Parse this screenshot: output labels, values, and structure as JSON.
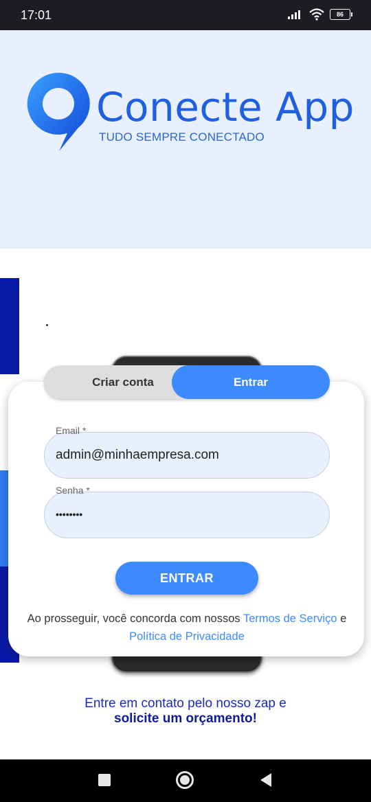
{
  "status_bar": {
    "time": "17:01",
    "battery": "86"
  },
  "brand": {
    "name": "Conecte App",
    "tagline": "TUDO SEMPRE CONECTADO"
  },
  "tabs": [
    {
      "label": "Criar conta",
      "active": false
    },
    {
      "label": "Entrar",
      "active": true
    }
  ],
  "form": {
    "email": {
      "label": "Email *",
      "value": "admin@minhaempresa.com"
    },
    "password": {
      "label": "Senha *",
      "value": "••••••••"
    },
    "submit_label": "ENTRAR"
  },
  "terms": {
    "prefix": "Ao prosseguir, você concorda com nossos ",
    "terms_link": "Termos de Serviço",
    "joiner": " e ",
    "privacy_link": "Política de Privacidade"
  },
  "contact": {
    "line1": "Entre em contato pelo nosso zap e",
    "line2": "solicite um orçamento!"
  },
  "colors": {
    "accent": "#3d8bff",
    "header_bg": "#e8f0fe",
    "brand_blue": "#1f5fe0",
    "side_navy": "#0a1aa8",
    "side_blue": "#2f7cf6"
  }
}
